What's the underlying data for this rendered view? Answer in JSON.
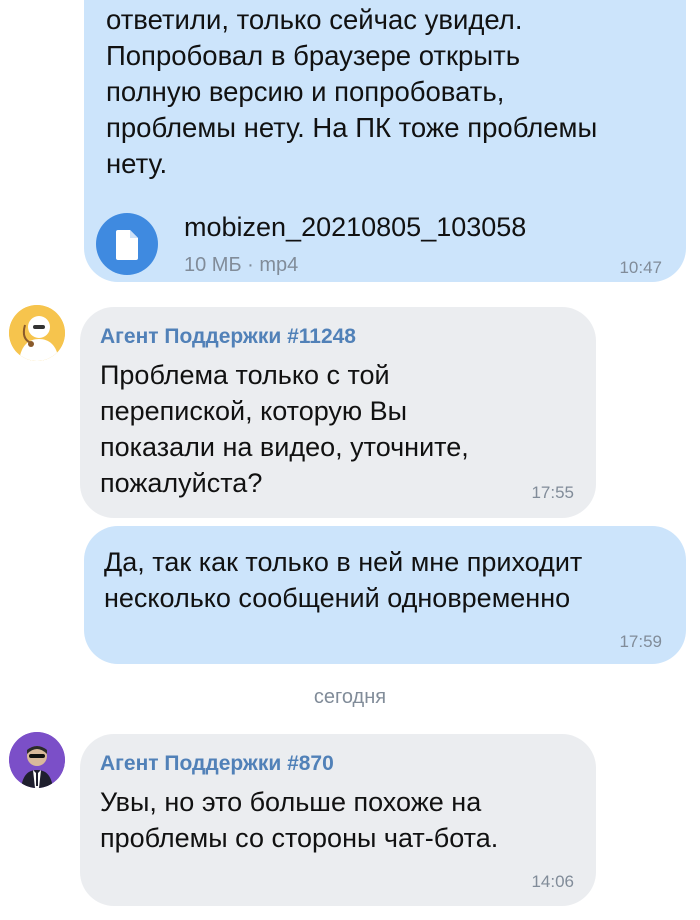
{
  "messages": {
    "m1": {
      "text": "ответили, только сейчас увидел.\nПопробовал в браузере открыть\nполную версию и попробовать,\nпроблемы нету. На ПК тоже проблемы\nнету.",
      "attachment": {
        "file_name": "mobizen_20210805_103058",
        "file_meta": "10 МБ · mp4",
        "icon": "document-icon"
      },
      "time": "10:47"
    },
    "m2": {
      "sender": "Агент Поддержки #11248",
      "text": "Проблема только с той\nперепиской, которую Вы\nпоказали на видео, уточните,\nпожалуйста?",
      "time": "17:55"
    },
    "m3": {
      "text": "Да, так как только в ней мне приходит\nнесколько сообщений одновременно",
      "time": "17:59"
    },
    "date_separator": "сегодня",
    "m4": {
      "sender": "Агент Поддержки #870",
      "text": "Увы, но это больше похоже на\nпроблемы со стороны чат-бота.",
      "time": "14:06"
    }
  },
  "colors": {
    "outgoing_bubble": "#cce4fb",
    "incoming_bubble": "#ebedf0",
    "sender_name": "#5181b8",
    "file_icon": "#3f8ae0",
    "timestamp": "#818c99"
  }
}
